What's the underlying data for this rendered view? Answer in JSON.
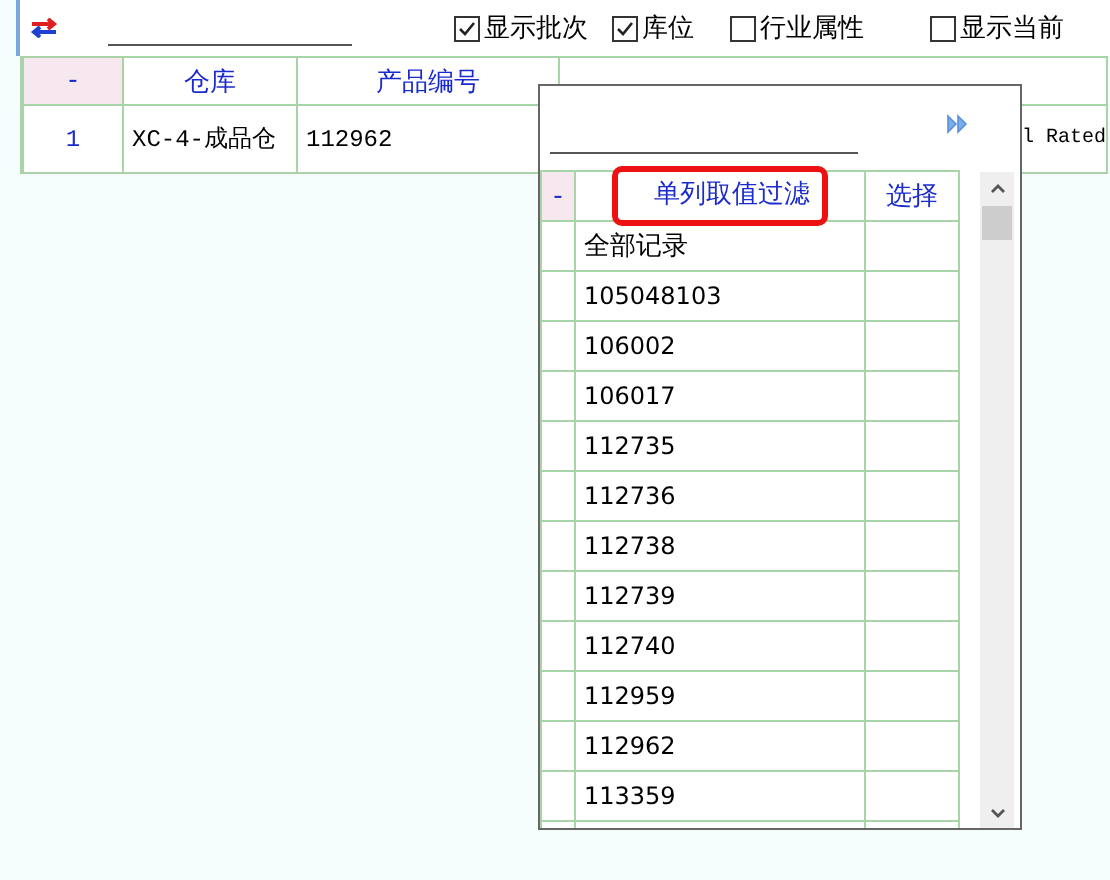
{
  "toolbar": {
    "checkboxes": [
      {
        "label": "显示批次",
        "checked": true
      },
      {
        "label": "库位",
        "checked": true
      },
      {
        "label": "行业属性",
        "checked": false
      },
      {
        "label": "显示当前",
        "checked": false
      }
    ]
  },
  "table": {
    "columns": [
      "-",
      "仓库",
      "产品编号"
    ],
    "rows": [
      {
        "cells": [
          "1",
          "XC-4-成品仓",
          "112962",
          "l Rated"
        ]
      }
    ]
  },
  "filter_popup": {
    "columns": [
      {
        "label": "-",
        "highlighted": false
      },
      {
        "label": "单列取值过滤",
        "highlighted": true
      },
      {
        "label": "选择",
        "highlighted": false
      }
    ],
    "values": [
      "全部记录",
      "105048103",
      "106002",
      "106017",
      "112735",
      "112736",
      "112738",
      "112739",
      "112740",
      "112959",
      "112962",
      "113359"
    ]
  }
}
